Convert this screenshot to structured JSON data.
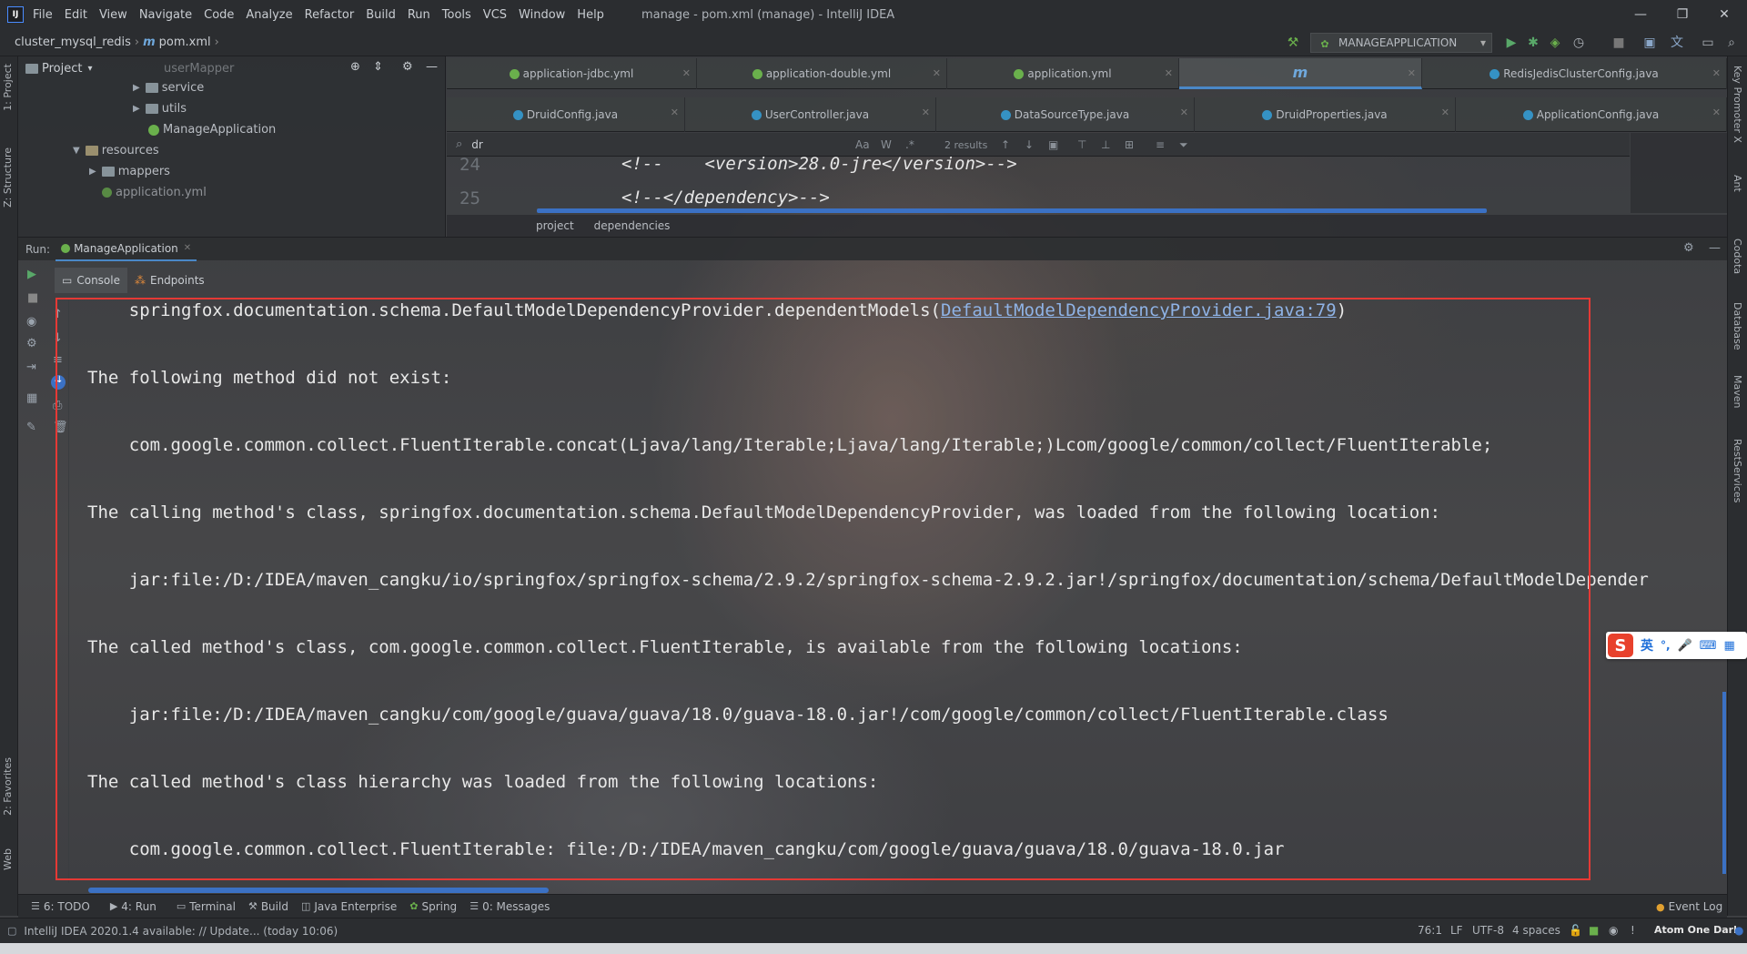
{
  "menubar": {
    "items": [
      "File",
      "Edit",
      "View",
      "Navigate",
      "Code",
      "Analyze",
      "Refactor",
      "Build",
      "Run",
      "Tools",
      "VCS",
      "Window",
      "Help"
    ],
    "title": "manage - pom.xml (manage) - IntelliJ IDEA",
    "minimize": "—",
    "restore": "❐",
    "close": "✕"
  },
  "breadcrumb": {
    "project": "cluster_mysql_redis",
    "file_icon": "m",
    "file": "pom.xml"
  },
  "toolbar": {
    "run_config": "MANAGEAPPLICATION"
  },
  "left_strip": {
    "project": "1: Project",
    "structure": "Z: Structure",
    "favorites": "2: Favorites",
    "web": "Web"
  },
  "right_strip": {
    "key_promoter": "Key Promoter X",
    "ant": "Ant",
    "codota": "Codota",
    "database": "Database",
    "maven": "Maven",
    "rest": "RestServices"
  },
  "project_panel": {
    "title": "Project",
    "items": [
      {
        "label": "userMapper"
      },
      {
        "label": "service"
      },
      {
        "label": "utils"
      },
      {
        "label": "ManageApplication"
      },
      {
        "label": "resources"
      },
      {
        "label": "mappers"
      },
      {
        "label": "application.yml"
      }
    ]
  },
  "editor_tabs": {
    "row1": [
      "application-jdbc.yml",
      "application-double.yml",
      "application.yml",
      "m",
      "RedisJedisClusterConfig.java"
    ],
    "row2": [
      "DruidConfig.java",
      "UserController.java",
      "DataSourceType.java",
      "DruidProperties.java",
      "ApplicationConfig.java"
    ]
  },
  "search": {
    "query": "dr",
    "match_case": "Aa",
    "words": "W",
    "regex": ".*",
    "results": "2 results"
  },
  "editor": {
    "lines": [
      {
        "num": "24",
        "text": "<!--    <version>28.0-jre</version>-->"
      },
      {
        "num": "25",
        "text": "<!--</dependency>-->"
      }
    ],
    "crumbs": [
      "project",
      "dependencies"
    ]
  },
  "run_panel": {
    "label": "Run:",
    "tab": "ManageApplication",
    "subtabs": [
      "Console",
      "Endpoints"
    ]
  },
  "console": {
    "line1_prefix": "    springfox.documentation.schema.DefaultModelDependencyProvider.dependentModels(",
    "line1_link": "DefaultModelDependencyProvider.java:79",
    "line1_suffix": ")",
    "line2": "The following method did not exist:",
    "line3": "    com.google.common.collect.FluentIterable.concat(Ljava/lang/Iterable;Ljava/lang/Iterable;)Lcom/google/common/collect/FluentIterable;",
    "line4": "The calling method's class, springfox.documentation.schema.DefaultModelDependencyProvider, was loaded from the following location:",
    "line5": "    jar:file:/D:/IDEA/maven_cangku/io/springfox/springfox-schema/2.9.2/springfox-schema-2.9.2.jar!/springfox/documentation/schema/DefaultModelDepender",
    "line6": "The called method's class, com.google.common.collect.FluentIterable, is available from the following locations:",
    "line7": "    jar:file:/D:/IDEA/maven_cangku/com/google/guava/guava/18.0/guava-18.0.jar!/com/google/common/collect/FluentIterable.class",
    "line8": "The called method's class hierarchy was loaded from the following locations:",
    "line9": "    com.google.common.collect.FluentIterable: file:/D:/IDEA/maven_cangku/com/google/guava/guava/18.0/guava-18.0.jar"
  },
  "bottom_tools": [
    "6: TODO",
    "4: Run",
    "Terminal",
    "Build",
    "Java Enterprise",
    "Spring",
    "0: Messages"
  ],
  "event_log": "Event Log",
  "status": {
    "message": "IntelliJ IDEA 2020.1.4 available: // Update... (today 10:06)",
    "position": "76:1",
    "line_sep": "LF",
    "encoding": "UTF-8",
    "indent": "4 spaces",
    "theme": "Atom One Dark"
  },
  "ime": {
    "logo": "S",
    "lang": "英"
  },
  "colors": {
    "accent": "#4a88c7",
    "highlight_box": "#e53935",
    "link": "#8fb3e6"
  }
}
